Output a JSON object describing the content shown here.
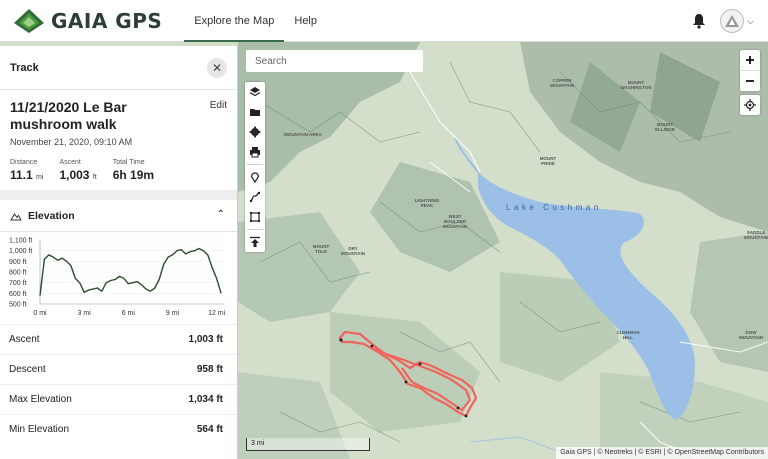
{
  "header": {
    "logo_text": "GAIA GPS",
    "nav": [
      "Explore the Map",
      "Help"
    ],
    "active_nav": 0
  },
  "panel": {
    "title": "Track",
    "track_name": "11/21/2020 Le Bar mushroom walk",
    "edit_label": "Edit",
    "date": "November 21, 2020, 09:10 AM",
    "stats": [
      {
        "label": "Distance",
        "value": "11.1",
        "unit": "mi"
      },
      {
        "label": "Ascent",
        "value": "1,003",
        "unit": "ft"
      },
      {
        "label": "Total Time",
        "value": "6h 19m",
        "unit": ""
      }
    ],
    "elevation_title": "Elevation",
    "rows": [
      {
        "label": "Ascent",
        "value": "1,003 ft"
      },
      {
        "label": "Descent",
        "value": "958 ft"
      },
      {
        "label": "Max Elevation",
        "value": "1,034 ft"
      },
      {
        "label": "Min Elevation",
        "value": "564 ft"
      }
    ]
  },
  "chart_data": {
    "type": "line",
    "title": "Elevation",
    "xlabel": "",
    "ylabel": "",
    "x_ticks": [
      "0 mi",
      "3 mi",
      "6 mi",
      "9 mi",
      "12 mi"
    ],
    "y_ticks": [
      "1,100 ft",
      "1,000 ft",
      "900 ft",
      "800 ft",
      "700 ft",
      "600 ft",
      "500 ft"
    ],
    "xlim": [
      0,
      12.5
    ],
    "ylim": [
      500,
      1100
    ],
    "series": [
      {
        "color": "#2e4d2e",
        "x": [
          0,
          0.3,
          0.6,
          0.9,
          1.2,
          1.5,
          1.8,
          2.1,
          2.4,
          2.7,
          3.0,
          3.3,
          3.6,
          3.9,
          4.2,
          4.5,
          4.8,
          5.1,
          5.4,
          5.7,
          6.0,
          6.3,
          6.6,
          6.9,
          7.2,
          7.5,
          7.8,
          8.1,
          8.4,
          8.7,
          9.0,
          9.3,
          9.6,
          9.9,
          10.2,
          10.5,
          10.8,
          11.1,
          11.4,
          11.7,
          12.0,
          12.3
        ],
        "y": [
          580,
          920,
          960,
          940,
          910,
          930,
          900,
          860,
          740,
          700,
          610,
          630,
          640,
          650,
          620,
          700,
          720,
          730,
          760,
          740,
          690,
          700,
          710,
          680,
          640,
          620,
          650,
          730,
          870,
          940,
          960,
          1000,
          1010,
          970,
          990,
          1000,
          1020,
          1000,
          960,
          840,
          740,
          600
        ]
      }
    ]
  },
  "map": {
    "search_placeholder": "Search",
    "lake_label": "Lake Cushman",
    "scale_label": "3 mi",
    "attribution": "Gaia GPS | © Neotreks | © ESRI | © OpenStreetMap Contributors",
    "labels": [
      {
        "text": "MOUNTAIN AREA",
        "id": "area"
      },
      {
        "text": "MOUNT WASHINGTON",
        "id": "mtwash"
      },
      {
        "text": "MOUNT ELLINOR",
        "id": "ellinor"
      },
      {
        "text": "COPPER MOUNTAIN",
        "id": "copper"
      },
      {
        "text": "MOUNT PRIDE",
        "id": "pride"
      },
      {
        "text": "LIGHTNING PEAK",
        "id": "lightning"
      },
      {
        "text": "WEST BOULDER MOUNTAIN",
        "id": "boulder"
      },
      {
        "text": "MOUNT TOLE",
        "id": "tole"
      },
      {
        "text": "DRY MOUNTAIN",
        "id": "dry"
      },
      {
        "text": "CUSHMAN HILL",
        "id": "cushman"
      },
      {
        "text": "SADDLE MOUNTAIN",
        "id": "saddle"
      },
      {
        "text": "DOW MOUNTAIN",
        "id": "dow"
      }
    ]
  }
}
